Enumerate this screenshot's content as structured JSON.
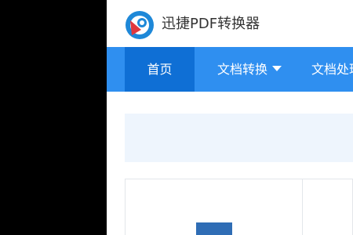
{
  "brand": {
    "name": "迅捷PDF转换器"
  },
  "nav": {
    "items": [
      {
        "label": "首页",
        "active": true
      },
      {
        "label": "文档转换",
        "active": false
      },
      {
        "label": "文档处理",
        "active": false
      }
    ]
  },
  "colors": {
    "nav_bg": "#2f8ff0",
    "nav_active": "#0f6fd5",
    "banner_bg": "#eef5fd",
    "logo_blue": "#1e88d8",
    "logo_red": "#e0383e"
  },
  "icons": {
    "logo": "xunjie-logo-icon",
    "dropdown": "caret-down-icon"
  }
}
